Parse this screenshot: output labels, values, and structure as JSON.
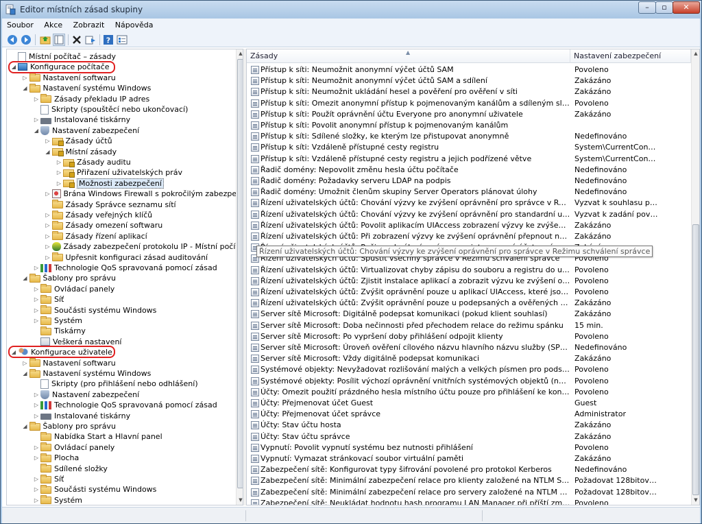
{
  "window": {
    "title": "Editor místních zásad skupiny",
    "controls": {
      "minimize": "–",
      "maximize": "▫",
      "close": "✕"
    }
  },
  "menu": [
    {
      "label": "Soubor"
    },
    {
      "label": "Akce"
    },
    {
      "label": "Zobrazit"
    },
    {
      "label": "Nápověda"
    }
  ],
  "toolbar": [
    "back-icon",
    "forward-icon",
    "up-folder-icon",
    "show-hide-tree-icon",
    "delete-icon",
    "export-list-icon",
    "help-icon",
    "properties-icon"
  ],
  "tree": [
    {
      "label": "Místní počítač – zásady",
      "level": 0,
      "icon": "doc",
      "exp": ""
    },
    {
      "label": "Konfigurace počítače",
      "level": 0,
      "icon": "pc",
      "exp": "◢"
    },
    {
      "label": "Nastavení softwaru",
      "level": 1,
      "icon": "folder",
      "exp": "▷"
    },
    {
      "label": "Nastavení systému Windows",
      "level": 1,
      "icon": "folder",
      "exp": "◢"
    },
    {
      "label": "Zásady překladu IP adres",
      "level": 2,
      "icon": "folder",
      "exp": "▷"
    },
    {
      "label": "Skripty (spouštěcí nebo ukončovací)",
      "level": 2,
      "icon": "doc",
      "exp": ""
    },
    {
      "label": "Instalované tiskárny",
      "level": 2,
      "icon": "printer",
      "exp": "▷"
    },
    {
      "label": "Nastavení zabezpečení",
      "level": 2,
      "icon": "shield",
      "exp": "◢"
    },
    {
      "label": "Zásady účtů",
      "level": 3,
      "icon": "lockfolder",
      "exp": "▷"
    },
    {
      "label": "Místní zásady",
      "level": 3,
      "icon": "lockfolder",
      "exp": "◢"
    },
    {
      "label": "Zásady auditu",
      "level": 4,
      "icon": "lockfolder",
      "exp": "▷"
    },
    {
      "label": "Přiřazení uživatelských práv",
      "level": 4,
      "icon": "lockfolder",
      "exp": "▷"
    },
    {
      "label": "Možnosti zabezpečení",
      "level": 4,
      "icon": "lockfolder",
      "exp": "▷",
      "selected": true
    },
    {
      "label": "Brána Windows Firewall s pokročilým zabezpečením",
      "level": 3,
      "icon": "fw",
      "exp": "▷"
    },
    {
      "label": "Zásady Správce seznamu sítí",
      "level": 3,
      "icon": "folder",
      "exp": ""
    },
    {
      "label": "Zásady veřejných klíčů",
      "level": 3,
      "icon": "folder",
      "exp": "▷"
    },
    {
      "label": "Zásady omezení softwaru",
      "level": 3,
      "icon": "folder",
      "exp": "▷"
    },
    {
      "label": "Zásady řízení aplikací",
      "level": 3,
      "icon": "folder",
      "exp": "▷"
    },
    {
      "label": "Zásady zabezpečení protokolu IP - Místní počítač",
      "level": 3,
      "icon": "ipsec",
      "exp": "▷"
    },
    {
      "label": "Upřesnit konfiguraci zásad auditování",
      "level": 3,
      "icon": "folder",
      "exp": "▷"
    },
    {
      "label": "Technologie QoS spravovaná pomocí zásad",
      "level": 2,
      "icon": "chart",
      "exp": "▷"
    },
    {
      "label": "Šablony pro správu",
      "level": 1,
      "icon": "folder",
      "exp": "◢"
    },
    {
      "label": "Ovládací panely",
      "level": 2,
      "icon": "folder",
      "exp": "▷"
    },
    {
      "label": "Síť",
      "level": 2,
      "icon": "folder",
      "exp": "▷"
    },
    {
      "label": "Součásti systému Windows",
      "level": 2,
      "icon": "folder",
      "exp": "▷"
    },
    {
      "label": "Systém",
      "level": 2,
      "icon": "folder",
      "exp": "▷"
    },
    {
      "label": "Tiskárny",
      "level": 2,
      "icon": "folder",
      "exp": ""
    },
    {
      "label": "Veškerá nastavení",
      "level": 2,
      "icon": "ctx",
      "exp": ""
    },
    {
      "label": "Konfigurace uživatele",
      "level": 0,
      "icon": "users",
      "exp": "◢"
    },
    {
      "label": "Nastavení softwaru",
      "level": 1,
      "icon": "folder",
      "exp": "▷"
    },
    {
      "label": "Nastavení systému Windows",
      "level": 1,
      "icon": "folder",
      "exp": "◢"
    },
    {
      "label": "Skripty (pro přihlášení nebo odhlášení)",
      "level": 2,
      "icon": "doc",
      "exp": ""
    },
    {
      "label": "Nastavení zabezpečení",
      "level": 2,
      "icon": "shield",
      "exp": "▷"
    },
    {
      "label": "Technologie QoS spravovaná pomocí zásad",
      "level": 2,
      "icon": "chart",
      "exp": "▷"
    },
    {
      "label": "Instalované tiskárny",
      "level": 2,
      "icon": "printer",
      "exp": "▷"
    },
    {
      "label": "Šablony pro správu",
      "level": 1,
      "icon": "folder",
      "exp": "◢"
    },
    {
      "label": "Nabídka Start a Hlavní panel",
      "level": 2,
      "icon": "folder",
      "exp": ""
    },
    {
      "label": "Ovládací panely",
      "level": 2,
      "icon": "folder",
      "exp": "▷"
    },
    {
      "label": "Plocha",
      "level": 2,
      "icon": "folder",
      "exp": "▷"
    },
    {
      "label": "Sdílené složky",
      "level": 2,
      "icon": "folder",
      "exp": ""
    },
    {
      "label": "Síť",
      "level": 2,
      "icon": "folder",
      "exp": "▷"
    },
    {
      "label": "Součásti systému Windows",
      "level": 2,
      "icon": "folder",
      "exp": "▷"
    },
    {
      "label": "Systém",
      "level": 2,
      "icon": "folder",
      "exp": "▷"
    }
  ],
  "list": {
    "columns": [
      "Zásady",
      "Nastavení zabezpečení"
    ],
    "rows": [
      {
        "policy": "Přístup k síti: Neumožnit anonymní výčet účtů SAM",
        "setting": "Povoleno"
      },
      {
        "policy": "Přístup k síti: Neumožnit anonymní výčet účtů SAM a sdílení",
        "setting": "Zakázáno"
      },
      {
        "policy": "Přístup k síti: Neumožnit ukládání hesel a pověření pro ověření v síti",
        "setting": "Zakázáno"
      },
      {
        "policy": "Přístup k síti: Omezit anonymní přístup k pojmenovaným kanálům a sdíleným složkám",
        "setting": "Povoleno"
      },
      {
        "policy": "Přístup k síti: Použít oprávnění účtu Everyone pro anonymní uživatele",
        "setting": "Zakázáno"
      },
      {
        "policy": "Přístup k síti: Povolit anonymní přístup k pojmenovaným kanálům",
        "setting": ""
      },
      {
        "policy": "Přístup k síti: Sdílené složky, ke kterým lze přistupovat anonymně",
        "setting": "Nedefinováno"
      },
      {
        "policy": "Přístup k síti: Vzdáleně přístupné cesty registru",
        "setting": "System\\CurrentControlS..."
      },
      {
        "policy": "Přístup k síti: Vzdáleně přístupné cesty registru a jejich podřízené větve",
        "setting": "System\\CurrentControlS..."
      },
      {
        "policy": "Řadič domény: Nepovolit změnu hesla účtu počítače",
        "setting": "Nedefinováno"
      },
      {
        "policy": "Řadič domény: Požadavky serveru LDAP na podpis",
        "setting": "Nedefinováno"
      },
      {
        "policy": "Řadič domény: Umožnit členům skupiny Server Operators plánovat úlohy",
        "setting": "Nedefinováno"
      },
      {
        "policy": "Řízení uživatelských účtů: Chování výzvy ke zvýšení oprávnění pro správce v Režimu schválení správce",
        "setting": "Vyzvat k souhlasu pro bi..."
      },
      {
        "policy": "Řízení uživatelských účtů: Chování výzvy ke zvýšení oprávnění pro standardní uživatele",
        "setting": "Vyzvat k zadání pověření"
      },
      {
        "policy": "Řízení uživatelských účtů: Povolit aplikacím UIAccess zobrazení výzvy ke zvýšení oprávnění bez po...",
        "setting": "Zakázáno"
      },
      {
        "policy": "Řízení uživatelských účtů: Při zobrazení výzvy ke zvýšení oprávnění přepnout na zabezpečenou plo...",
        "setting": "Zakázáno"
      },
      {
        "policy": "Řízení uživatelských účtů: Režim schválení správce pro integrovaný účet správce",
        "setting": "Zakázáno"
      },
      {
        "policy": "Řízení uživatelských účtů: Spustit všechny správce v Režimu schválení správce",
        "setting": "Povoleno"
      },
      {
        "policy": "Řízení uživatelských účtů: Virtualizovat chyby zápisu do souboru a registru do umístění jednotlivýc...",
        "setting": "Povoleno"
      },
      {
        "policy": "Řízení uživatelských účtů: Zjistit instalace aplikací a zobrazit výzvu ke zvýšení oprávnění",
        "setting": "Povoleno"
      },
      {
        "policy": "Řízení uživatelských účtů: Zvýšit oprávnění pouze u aplikací UIAccess, které jsou nainstalovány v za...",
        "setting": "Povoleno"
      },
      {
        "policy": "Řízení uživatelských účtů: Zvýšit oprávnění pouze u podepsaných a ověřených spustitelných soubo...",
        "setting": "Zakázáno"
      },
      {
        "policy": "Server sítě Microsoft: Digitálně podepsat komunikaci (pokud klient souhlasí)",
        "setting": "Zakázáno"
      },
      {
        "policy": "Server sítě Microsoft: Doba nečinnosti před přechodem relace do režimu spánku",
        "setting": "15 min."
      },
      {
        "policy": "Server sítě Microsoft: Po vypršení doby přihlášení odpojit klienty",
        "setting": "Povoleno"
      },
      {
        "policy": "Server sítě Microsoft: Úroveň ověření cílového názvu hlavního názvu služby (SPN) serveru",
        "setting": "Nedefinováno"
      },
      {
        "policy": "Server sítě Microsoft: Vždy digitálně podepsat komunikaci",
        "setting": "Zakázáno"
      },
      {
        "policy": "Systémové objekty: Nevyžadovat rozlišování malých a velkých písmen pro podsystémy nepatřící p...",
        "setting": "Povoleno"
      },
      {
        "policy": "Systémové objekty: Posílit výchozí oprávnění vnitřních systémových objektů (například symbolick...",
        "setting": "Povoleno"
      },
      {
        "policy": "Účty: Omezit použití prázdného hesla místního účtu pouze pro přihlášení ke konzole",
        "setting": "Povoleno"
      },
      {
        "policy": "Účty: Přejmenovat účet Guest",
        "setting": "Guest"
      },
      {
        "policy": "Účty: Přejmenovat účet správce",
        "setting": "Administrator"
      },
      {
        "policy": "Účty: Stav účtu hosta",
        "setting": "Zakázáno"
      },
      {
        "policy": "Účty: Stav účtu správce",
        "setting": "Zakázáno"
      },
      {
        "policy": "Vypnutí: Povolit vypnutí systému bez nutnosti přihlášení",
        "setting": "Povoleno"
      },
      {
        "policy": "Vypnutí: Vymazat stránkovací soubor virtuální paměti",
        "setting": "Zakázáno"
      },
      {
        "policy": "Zabezpečení sítě: Konfigurovat typy šifrování povolené pro protokol Kerberos",
        "setting": "Nedefinováno"
      },
      {
        "policy": "Zabezpečení sítě: Minimální zabezpečení relace pro klienty založené na NTLM SSP (včetně zabezpe...",
        "setting": "Požadovat 128bitové šifr..."
      },
      {
        "policy": "Zabezpečení sítě: Minimální zabezpečení relace pro servery založené na NTLM SSP (včetně zabezp...",
        "setting": "Požadovat 128bitové šifr..."
      },
      {
        "policy": "Zabezpečení sítě: Neukládat hodnotu hash programu LAN Manager při příští změně hesla",
        "setting": "Povoleno"
      }
    ],
    "tooltip": "Řízení uživatelských účtů: Chování výzvy ke zvýšení oprávnění pro správce v Režimu schválení správce"
  }
}
